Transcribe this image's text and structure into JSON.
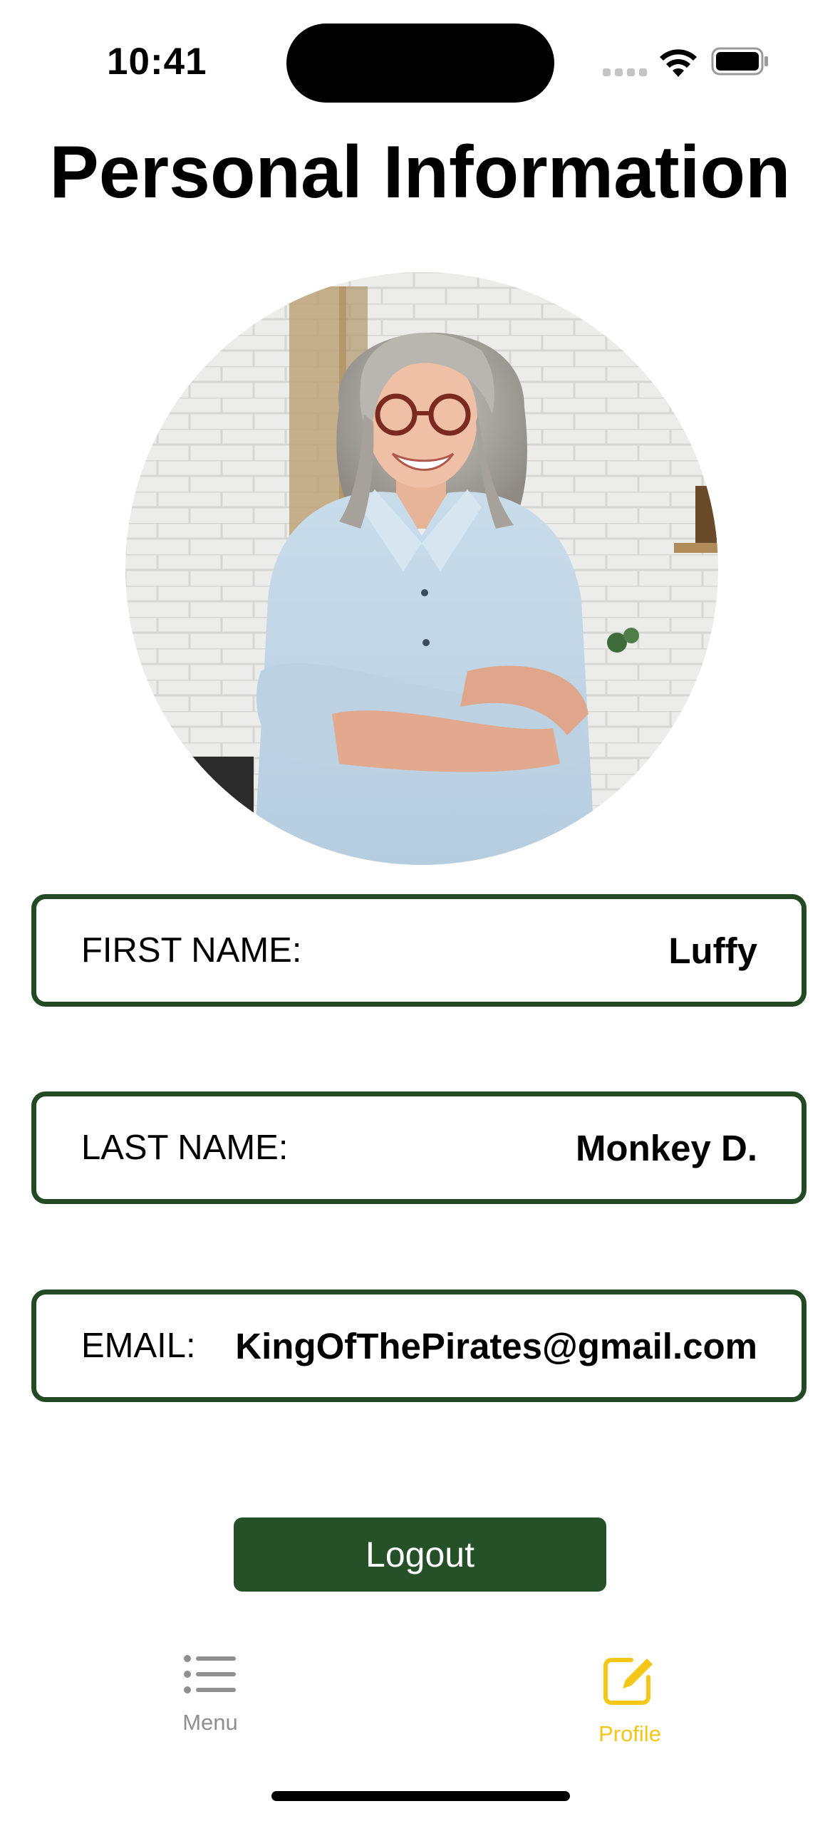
{
  "status_bar": {
    "time": "10:41"
  },
  "page": {
    "title": "Personal Information"
  },
  "profile": {
    "fields": [
      {
        "label": "FIRST NAME:",
        "value": "Luffy"
      },
      {
        "label": "LAST NAME:",
        "value": "Monkey D."
      },
      {
        "label": "EMAIL:",
        "value": "KingOfThePirates@gmail.com"
      }
    ],
    "logout_label": "Logout"
  },
  "tab_bar": {
    "items": [
      {
        "label": "Menu",
        "icon": "list-icon",
        "active": false
      },
      {
        "label": "Profile",
        "icon": "edit-square-icon",
        "active": true
      }
    ],
    "active_color": "#f5c518",
    "inactive_color": "#8f8f8f"
  },
  "colors": {
    "accent": "#265128",
    "border": "#234a25"
  }
}
